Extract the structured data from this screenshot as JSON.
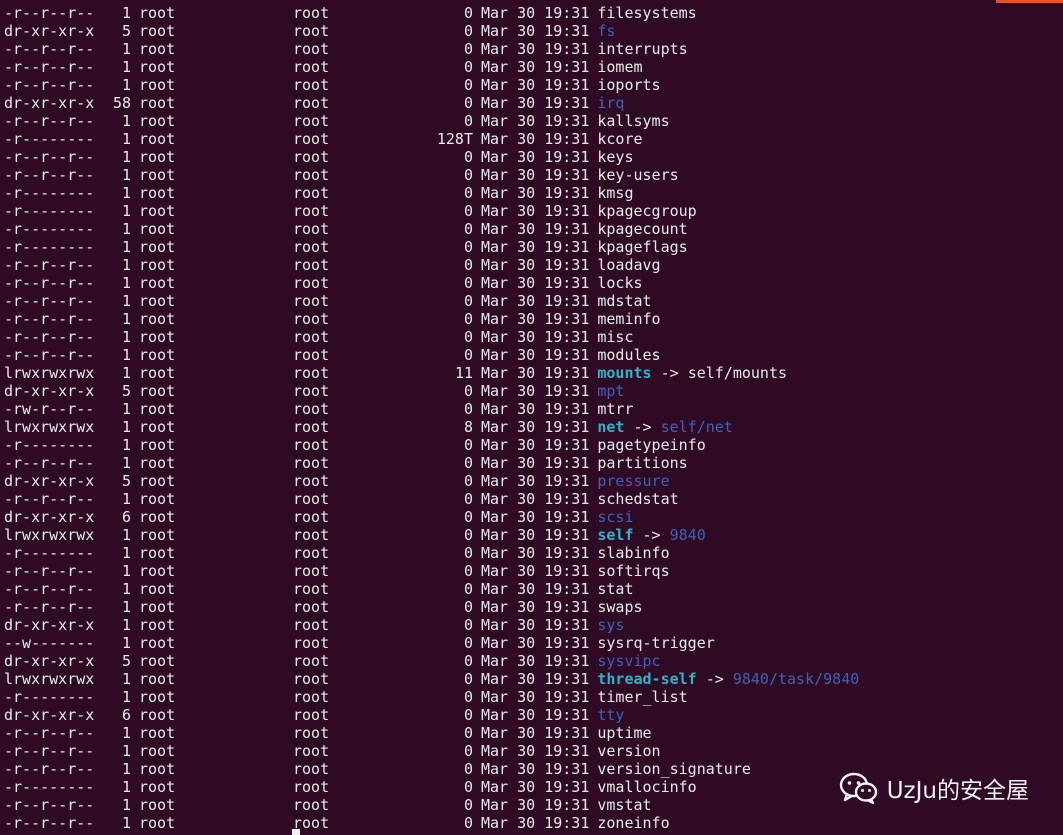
{
  "colors": {
    "background": "#2f0a24",
    "text": "#eaeaea",
    "directory": "#3f62b9",
    "symlink": "#2eb6c8",
    "accent": "#e95420"
  },
  "watermark": {
    "icon": "wechat-icon",
    "text": "UzJu的安全屋"
  },
  "listing": [
    {
      "perm": "-r--r--r--",
      "links": "1",
      "user": "root",
      "group": "root",
      "size": "0",
      "date": "Mar 30 19:31",
      "name": "filesystems",
      "type": "file"
    },
    {
      "perm": "dr-xr-xr-x",
      "links": "5",
      "user": "root",
      "group": "root",
      "size": "0",
      "date": "Mar 30 19:31",
      "name": "fs",
      "type": "dir"
    },
    {
      "perm": "-r--r--r--",
      "links": "1",
      "user": "root",
      "group": "root",
      "size": "0",
      "date": "Mar 30 19:31",
      "name": "interrupts",
      "type": "file"
    },
    {
      "perm": "-r--r--r--",
      "links": "1",
      "user": "root",
      "group": "root",
      "size": "0",
      "date": "Mar 30 19:31",
      "name": "iomem",
      "type": "file"
    },
    {
      "perm": "-r--r--r--",
      "links": "1",
      "user": "root",
      "group": "root",
      "size": "0",
      "date": "Mar 30 19:31",
      "name": "ioports",
      "type": "file"
    },
    {
      "perm": "dr-xr-xr-x",
      "links": "58",
      "user": "root",
      "group": "root",
      "size": "0",
      "date": "Mar 30 19:31",
      "name": "irq",
      "type": "dir"
    },
    {
      "perm": "-r--r--r--",
      "links": "1",
      "user": "root",
      "group": "root",
      "size": "0",
      "date": "Mar 30 19:31",
      "name": "kallsyms",
      "type": "file"
    },
    {
      "perm": "-r--------",
      "links": "1",
      "user": "root",
      "group": "root",
      "size": "128T",
      "date": "Mar 30 19:31",
      "name": "kcore",
      "type": "file"
    },
    {
      "perm": "-r--r--r--",
      "links": "1",
      "user": "root",
      "group": "root",
      "size": "0",
      "date": "Mar 30 19:31",
      "name": "keys",
      "type": "file"
    },
    {
      "perm": "-r--r--r--",
      "links": "1",
      "user": "root",
      "group": "root",
      "size": "0",
      "date": "Mar 30 19:31",
      "name": "key-users",
      "type": "file"
    },
    {
      "perm": "-r--------",
      "links": "1",
      "user": "root",
      "group": "root",
      "size": "0",
      "date": "Mar 30 19:31",
      "name": "kmsg",
      "type": "file"
    },
    {
      "perm": "-r--------",
      "links": "1",
      "user": "root",
      "group": "root",
      "size": "0",
      "date": "Mar 30 19:31",
      "name": "kpagecgroup",
      "type": "file"
    },
    {
      "perm": "-r--------",
      "links": "1",
      "user": "root",
      "group": "root",
      "size": "0",
      "date": "Mar 30 19:31",
      "name": "kpagecount",
      "type": "file"
    },
    {
      "perm": "-r--------",
      "links": "1",
      "user": "root",
      "group": "root",
      "size": "0",
      "date": "Mar 30 19:31",
      "name": "kpageflags",
      "type": "file"
    },
    {
      "perm": "-r--r--r--",
      "links": "1",
      "user": "root",
      "group": "root",
      "size": "0",
      "date": "Mar 30 19:31",
      "name": "loadavg",
      "type": "file"
    },
    {
      "perm": "-r--r--r--",
      "links": "1",
      "user": "root",
      "group": "root",
      "size": "0",
      "date": "Mar 30 19:31",
      "name": "locks",
      "type": "file"
    },
    {
      "perm": "-r--r--r--",
      "links": "1",
      "user": "root",
      "group": "root",
      "size": "0",
      "date": "Mar 30 19:31",
      "name": "mdstat",
      "type": "file"
    },
    {
      "perm": "-r--r--r--",
      "links": "1",
      "user": "root",
      "group": "root",
      "size": "0",
      "date": "Mar 30 19:31",
      "name": "meminfo",
      "type": "file"
    },
    {
      "perm": "-r--r--r--",
      "links": "1",
      "user": "root",
      "group": "root",
      "size": "0",
      "date": "Mar 30 19:31",
      "name": "misc",
      "type": "file"
    },
    {
      "perm": "-r--r--r--",
      "links": "1",
      "user": "root",
      "group": "root",
      "size": "0",
      "date": "Mar 30 19:31",
      "name": "modules",
      "type": "file"
    },
    {
      "perm": "lrwxrwxrwx",
      "links": "1",
      "user": "root",
      "group": "root",
      "size": "11",
      "date": "Mar 30 19:31",
      "name": "mounts",
      "type": "link",
      "target": "self/mounts",
      "target_type": "file"
    },
    {
      "perm": "dr-xr-xr-x",
      "links": "5",
      "user": "root",
      "group": "root",
      "size": "0",
      "date": "Mar 30 19:31",
      "name": "mpt",
      "type": "dir"
    },
    {
      "perm": "-rw-r--r--",
      "links": "1",
      "user": "root",
      "group": "root",
      "size": "0",
      "date": "Mar 30 19:31",
      "name": "mtrr",
      "type": "file"
    },
    {
      "perm": "lrwxrwxrwx",
      "links": "1",
      "user": "root",
      "group": "root",
      "size": "8",
      "date": "Mar 30 19:31",
      "name": "net",
      "type": "link",
      "target": "self/net",
      "target_type": "dir"
    },
    {
      "perm": "-r--------",
      "links": "1",
      "user": "root",
      "group": "root",
      "size": "0",
      "date": "Mar 30 19:31",
      "name": "pagetypeinfo",
      "type": "file"
    },
    {
      "perm": "-r--r--r--",
      "links": "1",
      "user": "root",
      "group": "root",
      "size": "0",
      "date": "Mar 30 19:31",
      "name": "partitions",
      "type": "file"
    },
    {
      "perm": "dr-xr-xr-x",
      "links": "5",
      "user": "root",
      "group": "root",
      "size": "0",
      "date": "Mar 30 19:31",
      "name": "pressure",
      "type": "dir"
    },
    {
      "perm": "-r--r--r--",
      "links": "1",
      "user": "root",
      "group": "root",
      "size": "0",
      "date": "Mar 30 19:31",
      "name": "schedstat",
      "type": "file"
    },
    {
      "perm": "dr-xr-xr-x",
      "links": "6",
      "user": "root",
      "group": "root",
      "size": "0",
      "date": "Mar 30 19:31",
      "name": "scsi",
      "type": "dir"
    },
    {
      "perm": "lrwxrwxrwx",
      "links": "1",
      "user": "root",
      "group": "root",
      "size": "0",
      "date": "Mar 30 19:31",
      "name": "self",
      "type": "link",
      "target": "9840",
      "target_type": "dir"
    },
    {
      "perm": "-r--------",
      "links": "1",
      "user": "root",
      "group": "root",
      "size": "0",
      "date": "Mar 30 19:31",
      "name": "slabinfo",
      "type": "file"
    },
    {
      "perm": "-r--r--r--",
      "links": "1",
      "user": "root",
      "group": "root",
      "size": "0",
      "date": "Mar 30 19:31",
      "name": "softirqs",
      "type": "file"
    },
    {
      "perm": "-r--r--r--",
      "links": "1",
      "user": "root",
      "group": "root",
      "size": "0",
      "date": "Mar 30 19:31",
      "name": "stat",
      "type": "file"
    },
    {
      "perm": "-r--r--r--",
      "links": "1",
      "user": "root",
      "group": "root",
      "size": "0",
      "date": "Mar 30 19:31",
      "name": "swaps",
      "type": "file"
    },
    {
      "perm": "dr-xr-xr-x",
      "links": "1",
      "user": "root",
      "group": "root",
      "size": "0",
      "date": "Mar 30 19:31",
      "name": "sys",
      "type": "dir"
    },
    {
      "perm": "--w-------",
      "links": "1",
      "user": "root",
      "group": "root",
      "size": "0",
      "date": "Mar 30 19:31",
      "name": "sysrq-trigger",
      "type": "file"
    },
    {
      "perm": "dr-xr-xr-x",
      "links": "5",
      "user": "root",
      "group": "root",
      "size": "0",
      "date": "Mar 30 19:31",
      "name": "sysvipc",
      "type": "dir"
    },
    {
      "perm": "lrwxrwxrwx",
      "links": "1",
      "user": "root",
      "group": "root",
      "size": "0",
      "date": "Mar 30 19:31",
      "name": "thread-self",
      "type": "link",
      "target": "9840/task/9840",
      "target_type": "dir"
    },
    {
      "perm": "-r--------",
      "links": "1",
      "user": "root",
      "group": "root",
      "size": "0",
      "date": "Mar 30 19:31",
      "name": "timer_list",
      "type": "file"
    },
    {
      "perm": "dr-xr-xr-x",
      "links": "6",
      "user": "root",
      "group": "root",
      "size": "0",
      "date": "Mar 30 19:31",
      "name": "tty",
      "type": "dir"
    },
    {
      "perm": "-r--r--r--",
      "links": "1",
      "user": "root",
      "group": "root",
      "size": "0",
      "date": "Mar 30 19:31",
      "name": "uptime",
      "type": "file"
    },
    {
      "perm": "-r--r--r--",
      "links": "1",
      "user": "root",
      "group": "root",
      "size": "0",
      "date": "Mar 30 19:31",
      "name": "version",
      "type": "file"
    },
    {
      "perm": "-r--r--r--",
      "links": "1",
      "user": "root",
      "group": "root",
      "size": "0",
      "date": "Mar 30 19:31",
      "name": "version_signature",
      "type": "file"
    },
    {
      "perm": "-r--------",
      "links": "1",
      "user": "root",
      "group": "root",
      "size": "0",
      "date": "Mar 30 19:31",
      "name": "vmallocinfo",
      "type": "file"
    },
    {
      "perm": "-r--r--r--",
      "links": "1",
      "user": "root",
      "group": "root",
      "size": "0",
      "date": "Mar 30 19:31",
      "name": "vmstat",
      "type": "file"
    },
    {
      "perm": "-r--r--r--",
      "links": "1",
      "user": "root",
      "group": "root",
      "size": "0",
      "date": "Mar 30 19:31",
      "name": "zoneinfo",
      "type": "file"
    }
  ]
}
